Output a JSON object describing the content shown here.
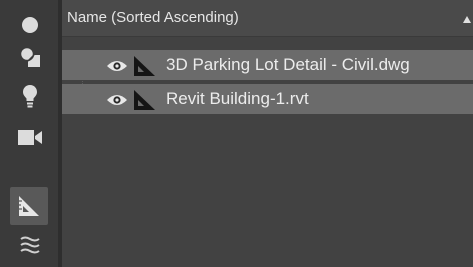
{
  "sidebar": {
    "items": [
      {
        "name": "circle"
      },
      {
        "name": "materials"
      },
      {
        "name": "lightbulb"
      },
      {
        "name": "video-camera"
      },
      {
        "name": "ruler-triangle",
        "active": true
      },
      {
        "name": "waves"
      }
    ]
  },
  "header": {
    "column_label": "Name (Sorted Ascending)",
    "sort": "ascending"
  },
  "rows": [
    {
      "label": "3D Parking Lot Detail - Civil.dwg",
      "selected": true
    },
    {
      "label": "Revit Building-1.rvt",
      "selected": true
    }
  ],
  "colors": {
    "background": "#424242",
    "sidebar": "#3a3a3a",
    "selected_row": "#6b6b6b",
    "text": "#ececec"
  }
}
